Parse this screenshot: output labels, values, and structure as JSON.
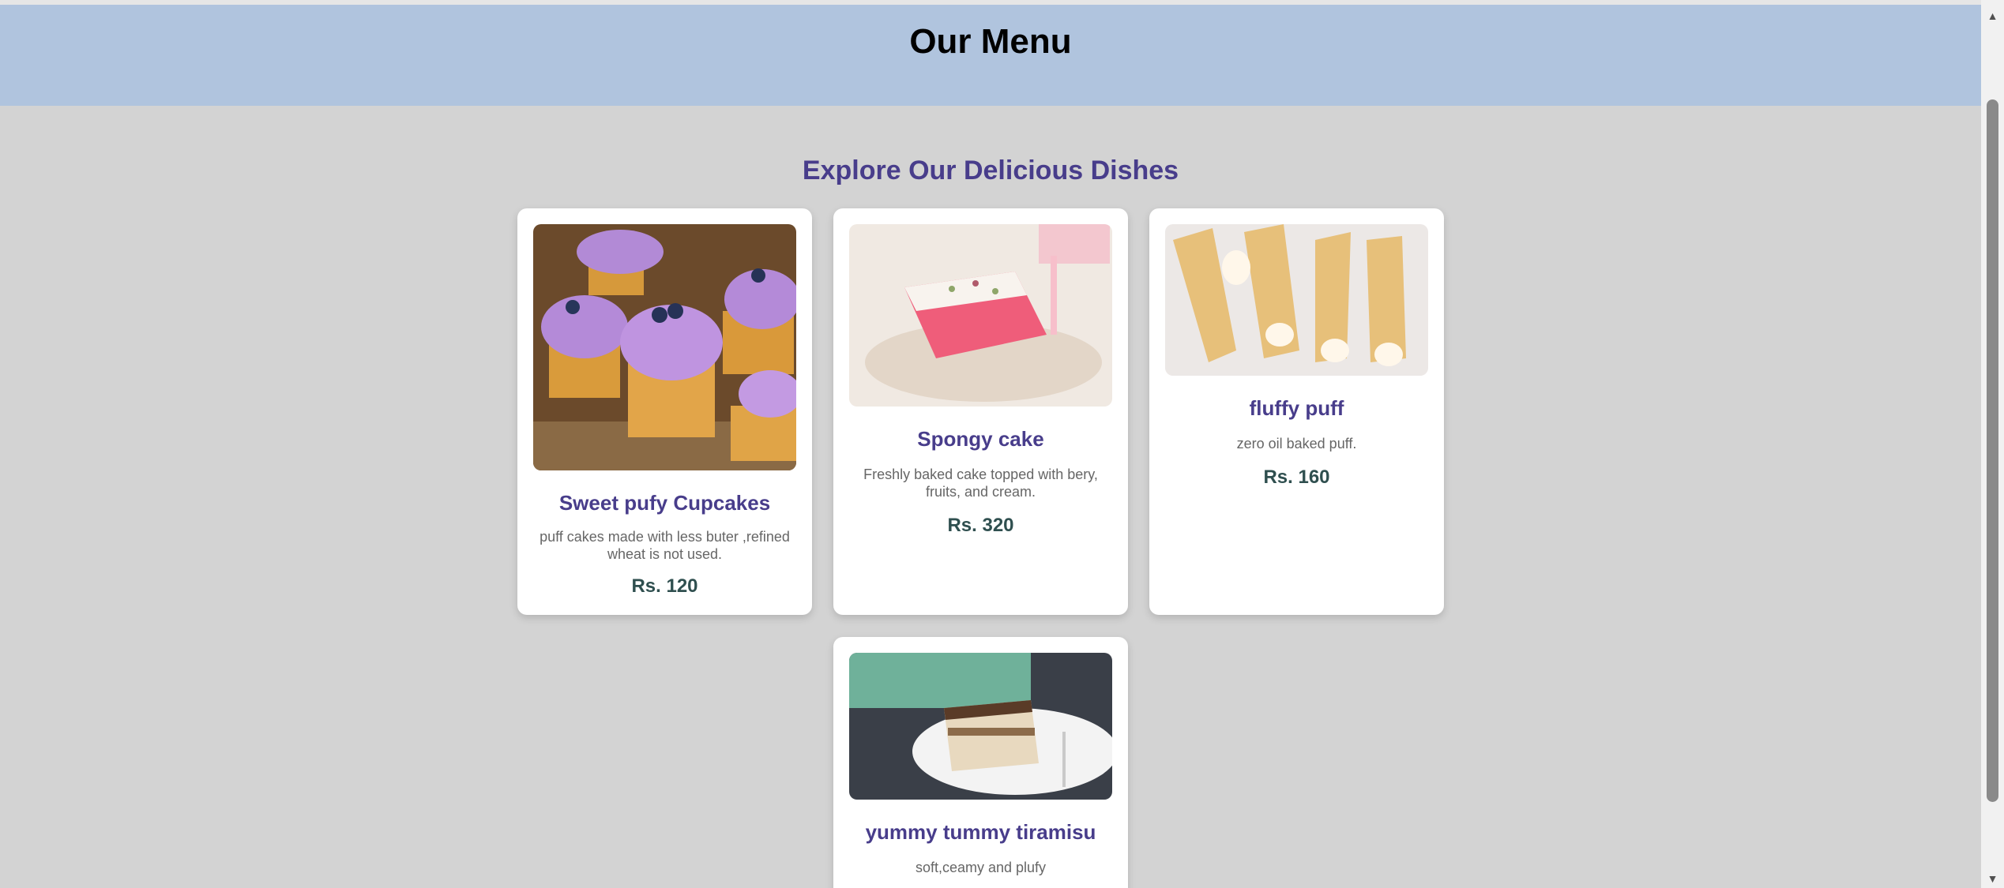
{
  "header": {
    "title": "Our Menu"
  },
  "section": {
    "subtitle": "Explore Our Delicious Dishes"
  },
  "menu": [
    {
      "name": "Sweet pufy Cupcakes",
      "description": "puff cakes made with less buter ,refined wheat is not used.",
      "price": "Rs. 120",
      "image": "cupcakes"
    },
    {
      "name": "Spongy cake",
      "description": "Freshly baked cake topped with bery, fruits, and cream.",
      "price": "Rs. 320",
      "image": "sponge-cake"
    },
    {
      "name": "fluffy puff",
      "description": "zero oil baked puff.",
      "price": "Rs. 160",
      "image": "cream-puff"
    },
    {
      "name": "yummy tummy tiramisu",
      "description": "soft,ceamy and plufy",
      "price": "",
      "image": "tiramisu"
    }
  ],
  "colors": {
    "header_bg": "#b0c4de",
    "page_bg": "#d3d3d3",
    "accent": "#483d8b",
    "price": "#2f4f4f"
  }
}
